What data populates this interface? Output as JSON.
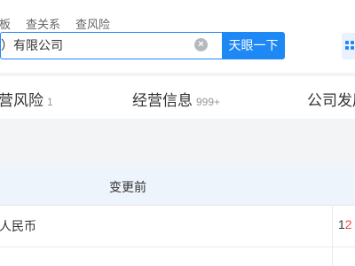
{
  "top_nav": {
    "tabs": [
      "板",
      "查关系",
      "查风险"
    ]
  },
  "search": {
    "value": "）有限公司",
    "clear_glyph": "×",
    "button_label": "天眼一下"
  },
  "category_tabs": [
    {
      "label": "营风险",
      "count": "1"
    },
    {
      "label": "经营信息",
      "count": "999+"
    },
    {
      "label": "公司发展",
      "count": ""
    }
  ],
  "table": {
    "header_before": "变更前",
    "row_cell_left": "人民币",
    "row_cell_right_first": "1",
    "row_cell_right_rest": "2"
  },
  "colors": {
    "accent": "#1e88f5",
    "highlight": "#f04a3e",
    "header_bg": "#eef4fc"
  }
}
